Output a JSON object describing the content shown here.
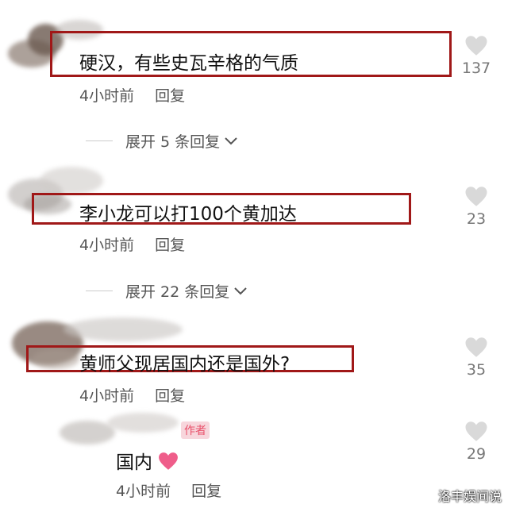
{
  "comments": [
    {
      "text": "硬汉，有些史瓦辛格的气质",
      "time": "4小时前",
      "reply": "回复",
      "likes": "137",
      "expand": "展开 5 条回复"
    },
    {
      "text": "李小龙可以打100个黄加达",
      "time": "4小时前",
      "reply": "回复",
      "likes": "23",
      "expand": "展开 22 条回复"
    },
    {
      "text": "黄师父现居国内还是国外?",
      "time": "4小时前",
      "reply": "回复",
      "likes": "35"
    }
  ],
  "author_reply": {
    "badge": "作者",
    "text": "国内",
    "time": "4小时前",
    "reply": "回复",
    "likes": "29"
  },
  "watermark": "洛丰娱间说",
  "colors": {
    "highlight_box": "#a01818",
    "author_badge_bg": "#f7d6dc",
    "author_badge_fg": "#e8506a",
    "heart_emoji": "#ef5d8a"
  }
}
